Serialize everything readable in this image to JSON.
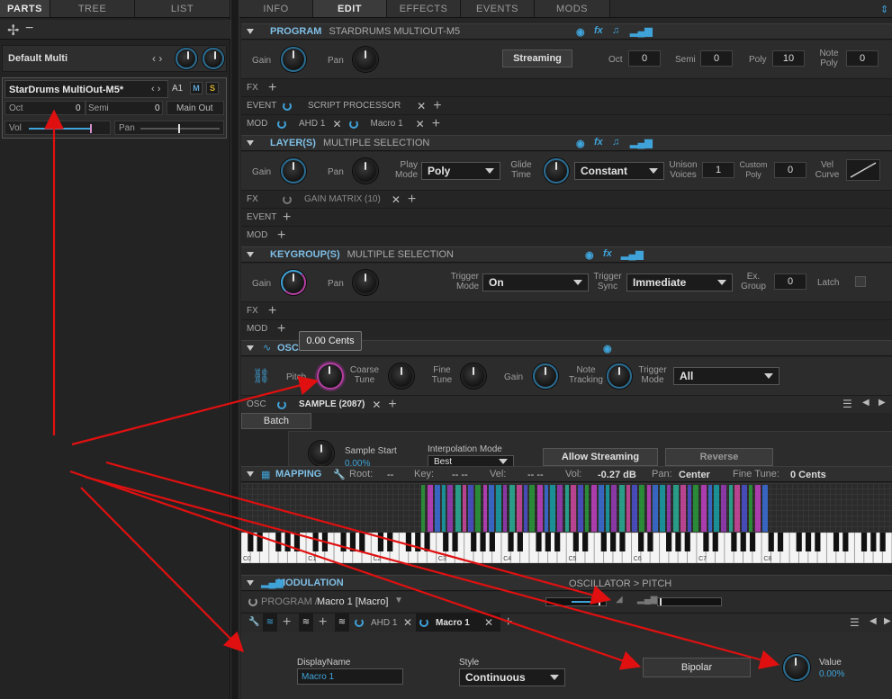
{
  "tabs_left": [
    "PARTS",
    "TREE",
    "LIST"
  ],
  "tabs_right": [
    "INFO",
    "EDIT",
    "EFFECTS",
    "EVENTS",
    "MODS"
  ],
  "parts": {
    "multi_name": "Default Multi",
    "part_name": "StarDrums MultiOut-M5*",
    "part_channel": "A1",
    "mute": "M",
    "solo": "S",
    "oct_label": "Oct",
    "oct_val": "0",
    "semi_label": "Semi",
    "semi_val": "0",
    "output": "Main Out",
    "vol_label": "Vol",
    "pan_label": "Pan"
  },
  "program": {
    "title": "PROGRAM",
    "subtitle": "STARDRUMS MULTIOUT-M5",
    "gain": "Gain",
    "pan": "Pan",
    "streaming": "Streaming",
    "oct": "Oct",
    "oct_val": "0",
    "semi": "Semi",
    "semi_val": "0",
    "poly": "Poly",
    "poly_val": "10",
    "note_poly": "Note Poly",
    "note_poly_val": "0",
    "fx": "FX",
    "event": "EVENT",
    "script": "SCRIPT PROCESSOR",
    "mod": "MOD",
    "ahd": "AHD 1",
    "macro": "Macro 1"
  },
  "layers": {
    "title": "LAYER(S)",
    "subtitle": "MULTIPLE SELECTION",
    "gain": "Gain",
    "pan": "Pan",
    "play_mode_lbl": "Play Mode",
    "play_mode": "Poly",
    "glide_lbl": "Glide Time",
    "glide_mode": "Constant",
    "unison_lbl": "Unison Voices",
    "unison_val": "1",
    "custom_poly_lbl": "Custom Poly",
    "custom_poly_val": "0",
    "vel_curve_lbl": "Vel Curve",
    "fx": "FX",
    "gain_matrix": "GAIN MATRIX (10)",
    "event": "EVENT",
    "mod": "MOD"
  },
  "keygroups": {
    "title": "KEYGROUP(S)",
    "subtitle": "MULTIPLE SELECTION",
    "gain": "Gain",
    "pan": "Pan",
    "trigger_mode_lbl": "Trigger Mode",
    "trigger_mode": "On",
    "trigger_sync_lbl": "Trigger Sync",
    "trigger_sync": "Immediate",
    "ex_group_lbl": "Ex. Group",
    "ex_group_val": "0",
    "latch": "Latch",
    "fx": "FX",
    "mod": "MOD"
  },
  "oscillator": {
    "title": "OSCILLATOR",
    "tooltip": "0.00 Cents",
    "pitch": "Pitch",
    "coarse": "Coarse Tune",
    "fine": "Fine Tune",
    "gain": "Gain",
    "note_tracking": "Note Tracking",
    "trigger_mode_lbl": "Trigger Mode",
    "trigger_mode": "All",
    "osc": "OSC",
    "sample": "SAMPLE (2087)",
    "batch": "Batch",
    "sample_start": "Sample Start",
    "sample_start_val": "0.00%",
    "interp_lbl": "Interpolation Mode",
    "interp_val": "Best",
    "allow_streaming": "Allow Streaming",
    "reverse": "Reverse"
  },
  "mapping": {
    "title": "MAPPING",
    "root": "Root:",
    "root_val": "--",
    "key": "Key:",
    "key_val": "-- --",
    "vel": "Vel:",
    "vel_val": "-- --",
    "vol": "Vol:",
    "vol_val": "-0.27 dB",
    "pan": "Pan:",
    "pan_val": "Center",
    "fine": "Fine Tune:",
    "fine_val": "0 Cents",
    "octave_labels": [
      "C0",
      "C1",
      "C2",
      "C3",
      "C4",
      "C5",
      "C6",
      "C7",
      "C8"
    ]
  },
  "modulation": {
    "title": "MODULATION",
    "path": "OSCILLATOR > PITCH",
    "source_prefix": "PROGRAM /",
    "source": "Macro 1 [Macro]",
    "ahd": "AHD 1",
    "macro": "Macro 1",
    "display_name_lbl": "DisplayName",
    "display_name_val": "Macro 1",
    "style_lbl": "Style",
    "style_val": "Continuous",
    "bipolar": "Bipolar",
    "value_lbl": "Value",
    "value_val": "0.00%"
  },
  "colors": {
    "accent": "#3fa3d9",
    "pink": "#b53fa3",
    "annotation": "#e01010"
  }
}
